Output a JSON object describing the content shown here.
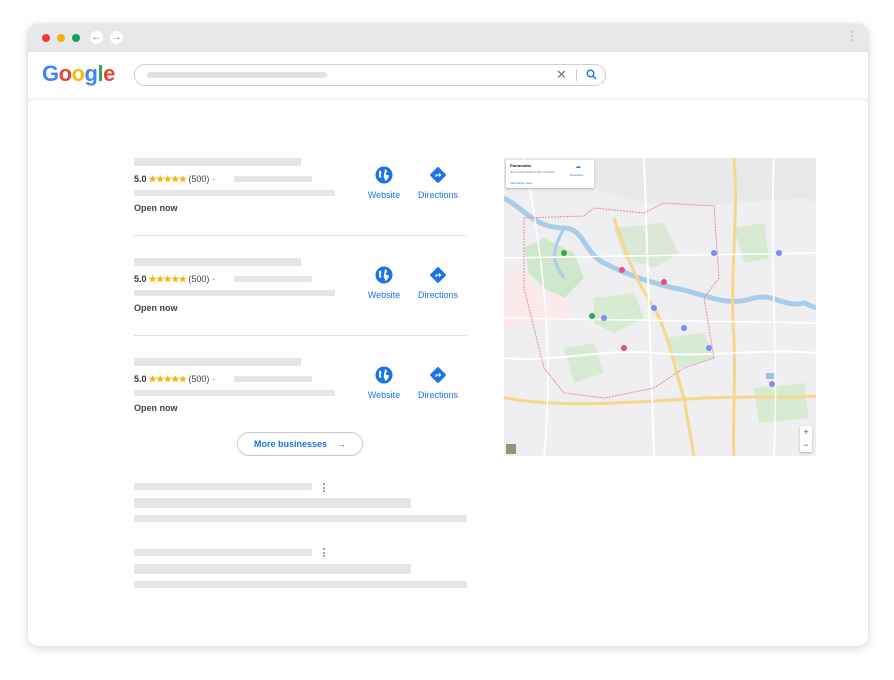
{
  "browser": {
    "back_icon": "arrow-left-icon",
    "forward_icon": "arrow-right-icon"
  },
  "header": {
    "logo": "Google",
    "logo_letters": [
      {
        "ch": "G",
        "color": "#4285F4"
      },
      {
        "ch": "o",
        "color": "#EA4335"
      },
      {
        "ch": "o",
        "color": "#FBBC05"
      },
      {
        "ch": "g",
        "color": "#4285F4"
      },
      {
        "ch": "l",
        "color": "#34A853"
      },
      {
        "ch": "e",
        "color": "#EA4335"
      }
    ],
    "clear": "✕"
  },
  "results": [
    {
      "rating": "5.0",
      "stars": "★★★★★",
      "count": "(500)",
      "sep": "·",
      "status": "Open now",
      "website_label": "Website",
      "directions_label": "Directions"
    },
    {
      "rating": "5.0",
      "stars": "★★★★★",
      "count": "(500)",
      "sep": "·",
      "status": "Open now",
      "website_label": "Website",
      "directions_label": "Directions"
    },
    {
      "rating": "5.0",
      "stars": "★★★★★",
      "count": "(500)",
      "sep": "·",
      "status": "Open now",
      "website_label": "Website",
      "directions_label": "Directions"
    }
  ],
  "more_button": {
    "label": "More businesses",
    "arrow": "→"
  },
  "map": {
    "card_title": "Parramatta",
    "card_subtitle": "New South Wales 2150, Australia",
    "card_link": "View larger map",
    "card_directions": "Directions",
    "zoom_in": "+",
    "zoom_out": "−"
  },
  "colors": {
    "accent": "#1a73e8",
    "star": "#f5b400"
  }
}
